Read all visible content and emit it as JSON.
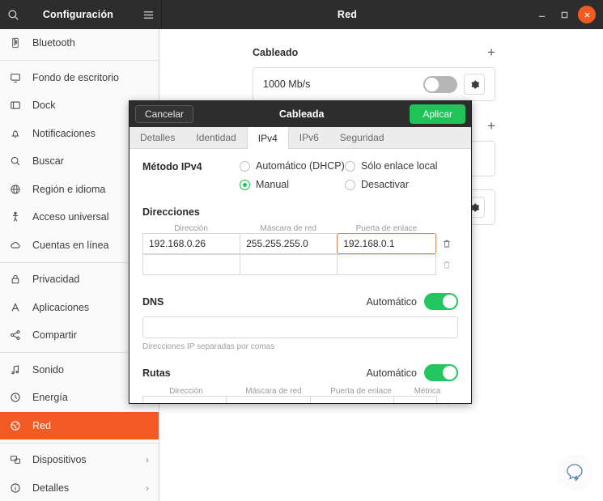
{
  "window_left": {
    "title": "Configuración",
    "search_icon": "search-icon",
    "menu_icon": "hamburger-menu-icon"
  },
  "window_right": {
    "title": "Red",
    "minimize": "−",
    "maximize": "□",
    "close": "✕"
  },
  "sidebar": {
    "items": [
      {
        "label": "Bluetooth",
        "icon": "bluetooth-icon",
        "active": false,
        "chevron": ""
      },
      {
        "label": "Fondo de escritorio",
        "icon": "desktop-icon",
        "active": false,
        "chevron": ""
      },
      {
        "label": "Dock",
        "icon": "dock-icon",
        "active": false,
        "chevron": ""
      },
      {
        "label": "Notificaciones",
        "icon": "bell-icon",
        "active": false,
        "chevron": ""
      },
      {
        "label": "Buscar",
        "icon": "search-icon",
        "active": false,
        "chevron": ""
      },
      {
        "label": "Región e idioma",
        "icon": "globe-icon",
        "active": false,
        "chevron": ""
      },
      {
        "label": "Acceso universal",
        "icon": "accessibility-icon",
        "active": false,
        "chevron": ""
      },
      {
        "label": "Cuentas en línea",
        "icon": "cloud-icon",
        "active": false,
        "chevron": ""
      },
      {
        "label": "Privacidad",
        "icon": "lock-icon",
        "active": false,
        "chevron": ""
      },
      {
        "label": "Aplicaciones",
        "icon": "applications-icon",
        "active": false,
        "chevron": ""
      },
      {
        "label": "Compartir",
        "icon": "share-icon",
        "active": false,
        "chevron": ""
      },
      {
        "label": "Sonido",
        "icon": "music-note-icon",
        "active": false,
        "chevron": ""
      },
      {
        "label": "Energía",
        "icon": "power-icon",
        "active": false,
        "chevron": ""
      },
      {
        "label": "Red",
        "icon": "network-globe-icon",
        "active": true,
        "chevron": ""
      },
      {
        "label": "Dispositivos",
        "icon": "devices-icon",
        "active": false,
        "chevron": "›"
      },
      {
        "label": "Detalles",
        "icon": "info-icon",
        "active": false,
        "chevron": "›"
      }
    ]
  },
  "main": {
    "section_title": "Cableado",
    "add_label": "+",
    "connection": {
      "speed": "1000 Mb/s",
      "enabled": false,
      "settings_icon": "gear-icon"
    },
    "section2_add_label": "+"
  },
  "dialog": {
    "cancel_label": "Cancelar",
    "title": "Cableada",
    "apply_label": "Aplicar",
    "tabs": [
      {
        "label": "Detalles",
        "active": false
      },
      {
        "label": "Identidad",
        "active": false
      },
      {
        "label": "IPv4",
        "active": true
      },
      {
        "label": "IPv6",
        "active": false
      },
      {
        "label": "Seguridad",
        "active": false
      }
    ],
    "method": {
      "label": "Método IPv4",
      "options": [
        {
          "label": "Automático (DHCP)",
          "selected": false
        },
        {
          "label": "Manual",
          "selected": true
        },
        {
          "label": "Sólo enlace local",
          "selected": false
        },
        {
          "label": "Desactivar",
          "selected": false
        }
      ]
    },
    "addresses": {
      "title": "Direcciones",
      "columns": [
        "Dirección",
        "Máscara de red",
        "Puerta de enlace"
      ],
      "rows": [
        {
          "address": "192.168.0.26",
          "netmask": "255.255.255.0",
          "gateway": "192.168.0.1",
          "focused_field": "gateway",
          "delete_icon": "trash-icon"
        },
        {
          "address": "",
          "netmask": "",
          "gateway": "",
          "focused_field": "",
          "delete_icon": "trash-icon"
        }
      ]
    },
    "dns": {
      "title": "DNS",
      "auto_label": "Automático",
      "auto_enabled": true,
      "value": "",
      "hint": "Direcciones IP separadas por comas"
    },
    "routes": {
      "title": "Rutas",
      "auto_label": "Automático",
      "auto_enabled": true,
      "columns": [
        "Dirección",
        "Máscara de red",
        "Puerta de enlace",
        "Métrica"
      ],
      "rows": [
        {
          "address": "",
          "netmask": "",
          "gateway": "",
          "metric": "",
          "delete_icon": "trash-icon"
        }
      ]
    }
  },
  "colors": {
    "accent_orange": "#f15a22",
    "accent_green": "#1fc357",
    "titlebar": "#2d2d2d",
    "focus_border": "#ef7b50"
  },
  "watermark": {
    "icon": "speech-bubble-logo-icon"
  }
}
